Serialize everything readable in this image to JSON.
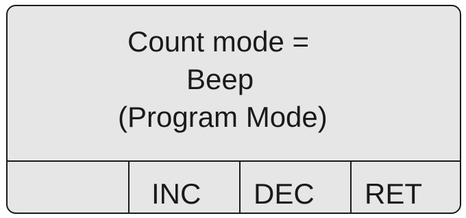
{
  "display": {
    "lines": [
      "Count mode =",
      "Beep",
      "(Program Mode)"
    ]
  },
  "softkeys": [
    "",
    "INC",
    "DEC",
    "RET"
  ]
}
